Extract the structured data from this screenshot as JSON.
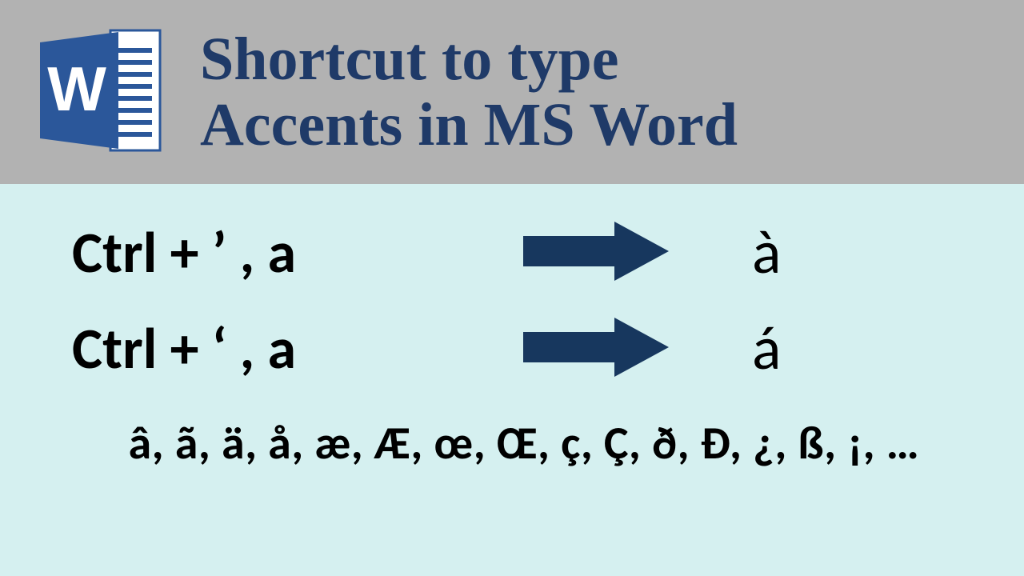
{
  "header": {
    "title": "Shortcut to type\nAccents in MS Word"
  },
  "rows": [
    {
      "shortcut": "Ctrl + ’ , a",
      "result": "à"
    },
    {
      "shortcut": "Ctrl + ‘ , a",
      "result": "á"
    }
  ],
  "footer_chars": "â, ã, ä, å, æ, Æ, œ, Œ, ç, Ç, ð, Đ, ¿, ß, ¡, …",
  "colors": {
    "accent": "#1f3a68",
    "arrow": "#17375e",
    "header_bg": "#b2b2b2",
    "body_bg": "#d5f0f0"
  },
  "icons": {
    "word": "word-icon",
    "arrow": "arrow-right-icon"
  }
}
